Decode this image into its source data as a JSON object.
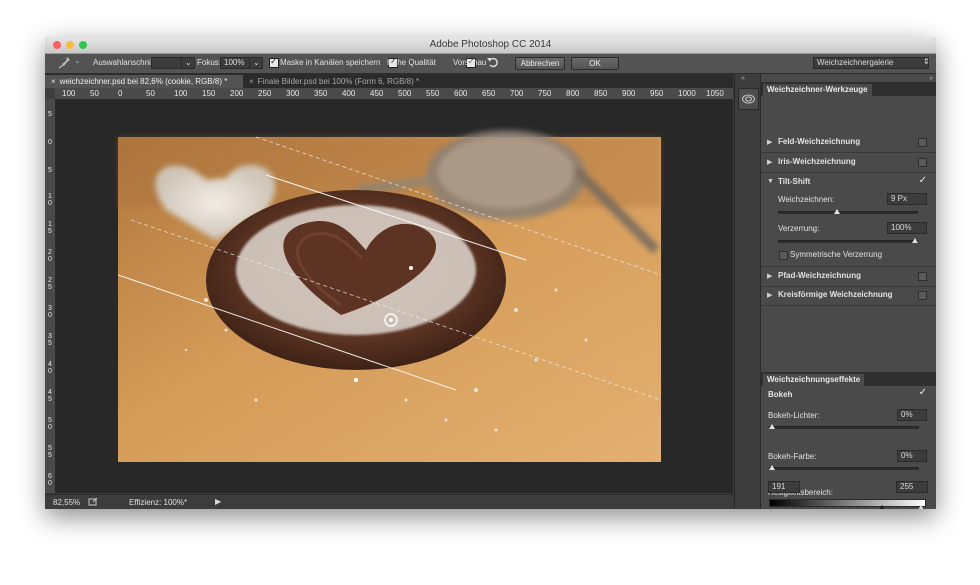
{
  "window": {
    "title": "Adobe Photoshop CC 2014"
  },
  "colors": {
    "close": "#fc605b",
    "minimize": "#fdbc40",
    "zoom": "#34c84a",
    "panel_bg": "#4a4a4a",
    "canvas_bg": "#282828"
  },
  "options": {
    "tool_icon": "pin-icon",
    "selection_label": "Auswahlanschnitt:",
    "selection_value": "",
    "focus_label": "Fokus:",
    "focus_value": "100%",
    "save_mask_label": "Maske in Kanälen speichern",
    "high_quality_label": "Hohe Qualität",
    "preview_label": "Vorschau",
    "reset_icon": "undo-icon",
    "cancel_label": "Abbrechen",
    "ok_label": "OK",
    "workspace_value": "Weichzeichnergalerie"
  },
  "tabs": [
    {
      "label": "weichzeichner.psd bei 82,6% (cookie, RGB/8) *"
    },
    {
      "label": "Finale Bilder.psd bei 100% (Form 6, RGB/8) *"
    }
  ],
  "ruler": {
    "h": [
      "100",
      "50",
      "0",
      "50",
      "100",
      "150",
      "200",
      "250",
      "300",
      "350",
      "400",
      "450",
      "500",
      "550",
      "600",
      "650",
      "700",
      "750",
      "800",
      "850",
      "900",
      "950",
      "1000",
      "1050"
    ],
    "v": [
      "5",
      "0",
      "5",
      "1 0",
      "1 5",
      "2 0",
      "2 5",
      "3 0",
      "3 5",
      "4 0",
      "4 5",
      "5 0",
      "5 5",
      "6 0"
    ]
  },
  "status": {
    "zoom": "82,55%",
    "efficiency": "Effizienz: 100%*"
  },
  "panel": {
    "tools_title": "Weichzeichner-Werkzeuge",
    "sections": [
      {
        "name": "Feld-Weichzeichnung"
      },
      {
        "name": "Iris-Weichzeichnung"
      },
      {
        "name": "Tilt-Shift"
      },
      {
        "name": "Pfad-Weichzeichnung"
      },
      {
        "name": "Kreisförmige Weichzeichnung"
      }
    ],
    "tiltshift": {
      "blur_label": "Weichzeichnen:",
      "blur_value": "9 Px",
      "distortion_label": "Verzerrung:",
      "distortion_value": "100%",
      "symmetric_label": "Symmetrische Verzerrung"
    },
    "effects_title": "Weichzeichnungseffekte",
    "bokeh_label": "Bokeh",
    "bokeh_lights_label": "Bokeh-Lichter:",
    "bokeh_lights_value": "0%",
    "bokeh_color_label": "Bokeh-Farbe:",
    "bokeh_color_value": "0%",
    "brightness_label": "Helligkeitsbereich:",
    "brightness_min": "191",
    "brightness_max": "255"
  }
}
